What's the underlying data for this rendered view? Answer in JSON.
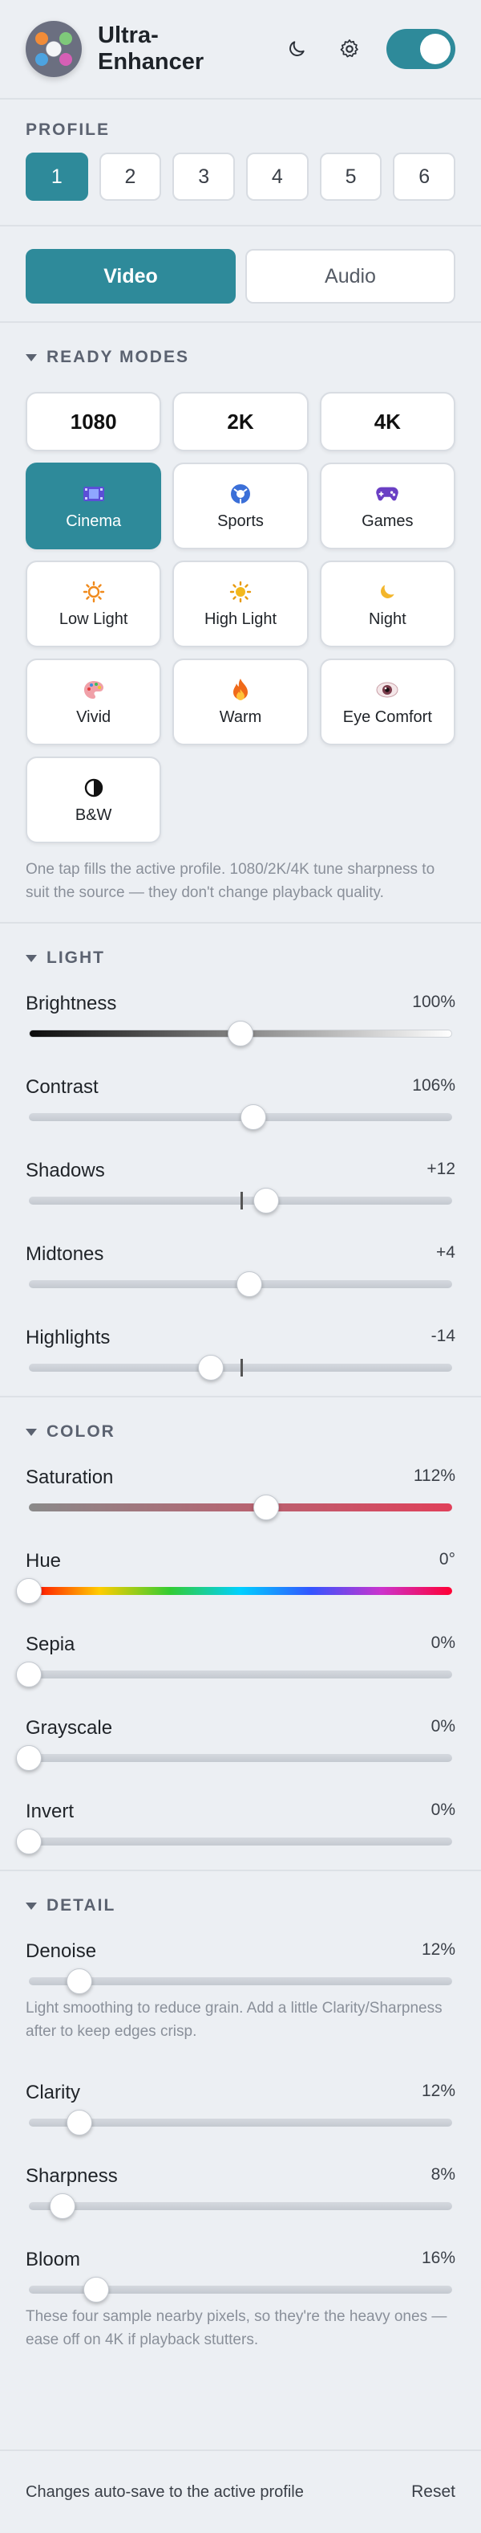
{
  "app": {
    "title": "Ultra-Enhancer",
    "enabled": true
  },
  "colors": {
    "accent": "#2e8a9a",
    "background": "#eceff3"
  },
  "icons": {
    "theme": "moon-icon",
    "settings": "gear-icon"
  },
  "profile": {
    "label": "PROFILE",
    "items": [
      "1",
      "2",
      "3",
      "4",
      "5",
      "6"
    ],
    "active": "1"
  },
  "media": {
    "items": [
      "Video",
      "Audio"
    ],
    "active": "Video"
  },
  "ready_modes": {
    "label": "READY MODES",
    "resolutions": [
      "1080",
      "2K",
      "4K"
    ],
    "modes": [
      {
        "label": "Cinema",
        "icon": "film-icon",
        "active": true
      },
      {
        "label": "Sports",
        "icon": "ball-icon"
      },
      {
        "label": "Games",
        "icon": "gamepad-icon"
      },
      {
        "label": "Low Light",
        "icon": "sun-icon"
      },
      {
        "label": "High Light",
        "icon": "bright-sun-icon"
      },
      {
        "label": "Night",
        "icon": "moon-icon"
      },
      {
        "label": "Vivid",
        "icon": "palette-icon"
      },
      {
        "label": "Warm",
        "icon": "flame-icon"
      },
      {
        "label": "Eye Comfort",
        "icon": "eye-icon"
      },
      {
        "label": "B&W",
        "icon": "half-circle-icon"
      }
    ],
    "hint": "One tap fills the active profile. 1080/2K/4K tune sharpness to suit the source — they don't change playback quality."
  },
  "light": {
    "label": "LIGHT",
    "sliders": [
      {
        "name": "Brightness",
        "value": "100%",
        "fraction": 0.5
      },
      {
        "name": "Contrast",
        "value": "106%",
        "fraction": 0.53
      },
      {
        "name": "Shadows",
        "value": "+12",
        "fraction": 0.56
      },
      {
        "name": "Midtones",
        "value": "+4",
        "fraction": 0.52
      },
      {
        "name": "Highlights",
        "value": "-14",
        "fraction": 0.43
      }
    ]
  },
  "color": {
    "label": "COLOR",
    "sliders": [
      {
        "name": "Saturation",
        "value": "112%",
        "fraction": 0.56
      },
      {
        "name": "Hue",
        "value": "0°",
        "fraction": 0.0
      },
      {
        "name": "Sepia",
        "value": "0%",
        "fraction": 0.0
      },
      {
        "name": "Grayscale",
        "value": "0%",
        "fraction": 0.0
      },
      {
        "name": "Invert",
        "value": "0%",
        "fraction": 0.0
      }
    ]
  },
  "detail": {
    "label": "DETAIL",
    "sliders": [
      {
        "name": "Denoise",
        "value": "12%",
        "fraction": 0.12
      },
      {
        "name": "Clarity",
        "value": "12%",
        "fraction": 0.12
      },
      {
        "name": "Sharpness",
        "value": "8%",
        "fraction": 0.08
      },
      {
        "name": "Bloom",
        "value": "16%",
        "fraction": 0.16
      }
    ],
    "denoise_hint": "Light smoothing to reduce grain. Add a little Clarity/Sharpness after to keep edges crisp.",
    "bloom_hint": "These four sample nearby pixels, so they're the heavy ones — ease off on 4K if playback stutters."
  },
  "footer": {
    "note": "Changes auto-save to the active profile",
    "reset": "Reset"
  }
}
